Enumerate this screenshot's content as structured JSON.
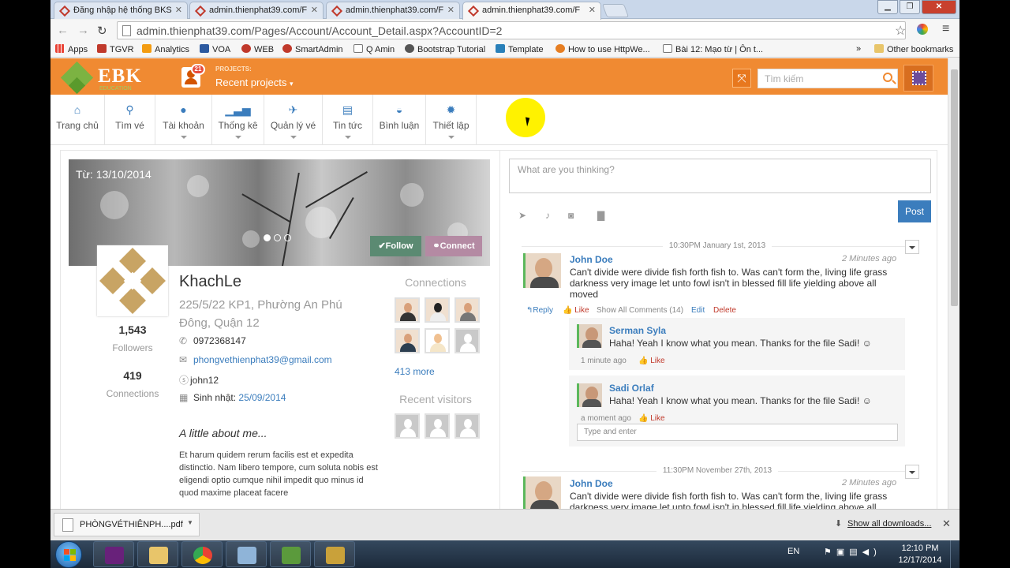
{
  "browser": {
    "tabs": [
      {
        "title": "Đăng nhập hệ thống BKS",
        "active": false
      },
      {
        "title": "admin.thienphat39.com/F",
        "active": false
      },
      {
        "title": "admin.thienphat39.com/F",
        "active": false
      },
      {
        "title": "admin.thienphat39.com/F",
        "active": true
      }
    ],
    "url": "admin.thienphat39.com/Pages/Account/Account_Detail.aspx?AccountID=2",
    "bookmarks": [
      {
        "label": "Apps",
        "color": "#e94235"
      },
      {
        "label": "TGVR",
        "color": "#c0392b"
      },
      {
        "label": "Analytics",
        "color": "#f39c12"
      },
      {
        "label": "VOA",
        "color": "#2c5aa0"
      },
      {
        "label": "WEB",
        "color": "#c0392b"
      },
      {
        "label": "SmartAdmin",
        "color": "#c0392b"
      },
      {
        "label": "Q Amin",
        "color": "#777777"
      },
      {
        "label": "Bootstrap Tutorial",
        "color": "#555555"
      },
      {
        "label": "Template",
        "color": "#2980b9"
      },
      {
        "label": "How to use HttpWe...",
        "color": "#e67e22"
      },
      {
        "label": "Bài 12: Mạo từ | Ôn t...",
        "color": "#777777"
      }
    ],
    "bookmarks_overflow": "»",
    "other_bookmarks": "Other bookmarks"
  },
  "header": {
    "logo_text": "EBK",
    "logo_sub": "EDUCATION",
    "projects_badge": "21",
    "projects_label": "PROJECTS:",
    "projects_value": "Recent projects",
    "search_placeholder": "Tìm kiếm"
  },
  "menu": [
    {
      "label": "Trang chủ",
      "icon": "home-icon",
      "glyph": "⌂",
      "caret": false
    },
    {
      "label": "Tìm vé",
      "icon": "search-icon",
      "glyph": "⚲",
      "caret": false
    },
    {
      "label": "Tài khoản",
      "icon": "user-icon",
      "glyph": "●",
      "caret": true
    },
    {
      "label": "Thống kê",
      "icon": "signal-icon",
      "glyph": "▁▃▅",
      "caret": true
    },
    {
      "label": "Quản lý vé",
      "icon": "plane-icon",
      "glyph": "✈",
      "caret": true
    },
    {
      "label": "Tin tức",
      "icon": "newspaper-icon",
      "glyph": "▤",
      "caret": true
    },
    {
      "label": "Bình luận",
      "icon": "inbox-icon",
      "glyph": "◒",
      "caret": false
    },
    {
      "label": "Thiết lập",
      "icon": "gear-icon",
      "glyph": "✹",
      "caret": true
    }
  ],
  "profile": {
    "cover_date": "Từ: 13/10/2014",
    "follow_label": "✔Follow",
    "connect_label": "⚭Connect",
    "followers_count": "1,543",
    "followers_label": "Followers",
    "connections_count": "419",
    "connections_label": "Connections",
    "name": "KhachLe",
    "address": "225/5/22 KP1, Phường An Phú Đông, Quận 12",
    "phone": "0972368147",
    "email": "phongvethienphat39@gmail.com",
    "skype": "john12",
    "birthday_label": "Sinh nhật:",
    "birthday": "25/09/2014",
    "about_title": "A little about me...",
    "about_text": "Et harum quidem rerum facilis est et expedita distinctio. Nam libero tempore, cum soluta nobis est eligendi optio cumque nihil impedit quo minus id quod maxime placeat facere",
    "connections_title": "Connections",
    "more_label": "413 more",
    "visitors_title": "Recent visitors"
  },
  "feed": {
    "post_placeholder": "What are you thinking?",
    "post_button": "Post",
    "items": [
      {
        "date": "10:30PM January 1st, 2013",
        "author": "John Doe",
        "time": "2 Minutes ago",
        "text": "Can't divide were divide fish forth fish to. Was can't form the, living life grass darkness very image let unto fowl isn't in blessed fill life yielding above all moved",
        "reply": "↰Reply",
        "like": "👍 Like",
        "show_all": "Show All Comments (14)",
        "edit": "Edit",
        "delete": "Delete",
        "replies": [
          {
            "author": "Serman Syla",
            "text": "Haha! Yeah I know what you mean. Thanks for the file Sadi! ☺",
            "time": "1 minute ago",
            "like": "👍 Like"
          },
          {
            "author": "Sadi Orlaf",
            "text": "Haha! Yeah I know what you mean. Thanks for the file Sadi! ☺",
            "time": "a moment ago",
            "like": "👍 Like"
          }
        ],
        "reply_placeholder": "Type and enter"
      },
      {
        "date": "11:30PM November 27th, 2013",
        "author": "John Doe",
        "time": "2 Minutes ago",
        "text": "Can't divide were divide fish forth fish to. Was can't form the, living life grass darkness very image let unto fowl isn't in blessed fill life yielding above all moved"
      }
    ]
  },
  "downloads": {
    "file": "PHÒNGVÉTHIÊNPH....pdf",
    "show_all": "Show all downloads...",
    "close": "✕"
  },
  "taskbar": {
    "lang": "EN",
    "time": "12:10 PM",
    "date": "12/17/2014"
  }
}
